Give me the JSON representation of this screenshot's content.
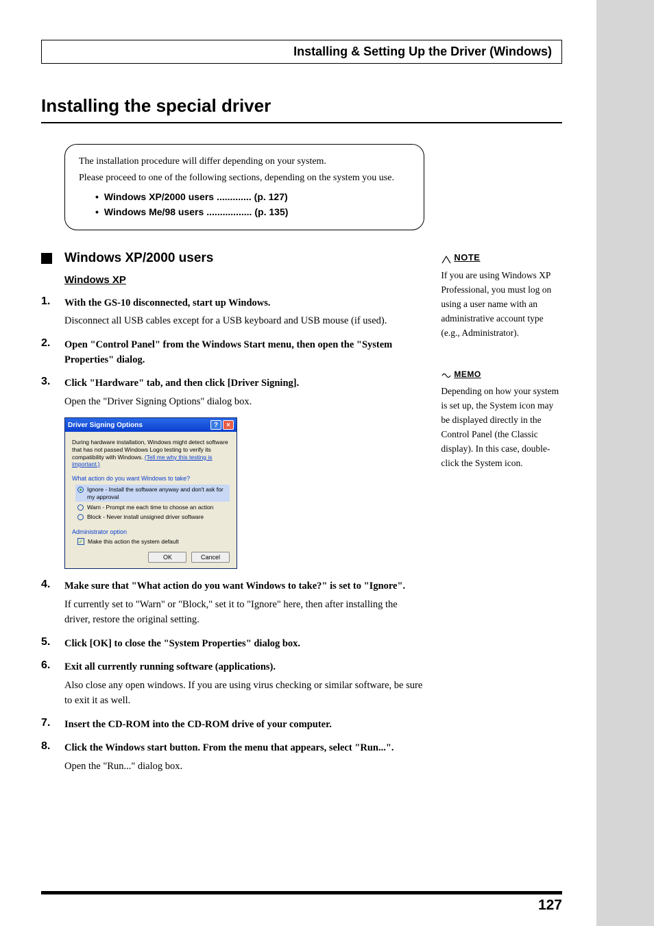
{
  "header": {
    "title": "Installing & Setting Up the Driver (Windows)"
  },
  "main_title": "Installing the special driver",
  "callout": {
    "intro1": "The installation procedure will differ depending on your system.",
    "intro2": "Please proceed to one of the following sections, depending on the system you use.",
    "items": [
      {
        "label": "Windows XP/2000 users",
        "dots": ".............",
        "page": "(p. 127)"
      },
      {
        "label": "Windows Me/98 users",
        "dots": ".................",
        "page": "(p. 135)"
      }
    ]
  },
  "section_heading": "Windows XP/2000 users",
  "sub_heading": "Windows XP",
  "steps": [
    {
      "n": "1.",
      "bold": "With the GS-10 disconnected, start up Windows.",
      "after": "Disconnect all USB cables except for a USB keyboard and USB mouse (if used)."
    },
    {
      "n": "2.",
      "bold": "Open \"Control Panel\" from the Windows Start menu, then open the \"System Properties\" dialog."
    },
    {
      "n": "3.",
      "bold": "Click \"Hardware\" tab, and then click [Driver Signing].",
      "after": "Open the \"Driver Signing Options\" dialog box."
    }
  ],
  "dialog": {
    "title": "Driver Signing Options",
    "help": "?",
    "close": "×",
    "desc_pre": "During hardware installation, Windows might detect software that has not passed Windows Logo testing to verify its compatibility with Windows. ",
    "desc_link": "(Tell me why this testing is important.)",
    "group1": "What action do you want Windows to take?",
    "opt_ignore": "Ignore - Install the software anyway and don't ask for my approval",
    "opt_warn": "Warn - Prompt me each time to choose an action",
    "opt_block": "Block - Never install unsigned driver software",
    "group2": "Administrator option",
    "chk": "Make this action the system default",
    "ok": "OK",
    "cancel": "Cancel"
  },
  "steps2": [
    {
      "n": "4.",
      "bold": "Make sure that \"What action do you want Windows to take?\" is set to \"Ignore\".",
      "after": "If currently set to \"Warn\" or \"Block,\" set it to \"Ignore\" here, then after installing the driver, restore the original setting."
    },
    {
      "n": "5.",
      "bold": "Click [OK] to close the \"System Properties\" dialog box."
    },
    {
      "n": "6.",
      "bold": "Exit all currently running software (applications).",
      "after": "Also close any open windows. If you are using virus checking or similar software, be sure to exit it as well."
    },
    {
      "n": "7.",
      "bold": "Insert the CD-ROM into the CD-ROM drive of your computer."
    },
    {
      "n": "8.",
      "bold": "Click the Windows start button. From the menu that appears, select \"Run...\".",
      "after": "Open the \"Run...\" dialog box."
    }
  ],
  "sidebar": {
    "note_label": "NOTE",
    "note_text": "If you are using Windows XP Professional, you must log on using a user name with an administrative account type (e.g., Administrator).",
    "memo_label": "MEMO",
    "memo_text": "Depending on how your system is set up, the System icon may be displayed directly in the Control Panel (the Classic display). In this case, double-click the System icon."
  },
  "page_number": "127"
}
